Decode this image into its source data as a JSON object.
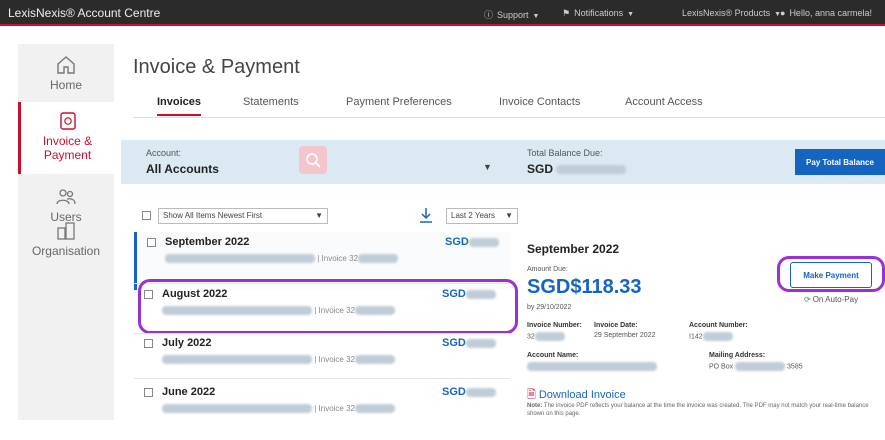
{
  "topbar": {
    "brand": "LexisNexis® Account Centre",
    "support": "Support",
    "notifications": "Notifications",
    "products": "LexisNexis® Products",
    "user": "Hello, anna carmela!"
  },
  "sidebar": {
    "items": [
      {
        "label": "Home"
      },
      {
        "label": "Invoice & Payment"
      },
      {
        "label": "Users"
      },
      {
        "label": "Organisation"
      }
    ]
  },
  "page": {
    "title": "Invoice & Payment"
  },
  "tabs": [
    {
      "label": "Invoices"
    },
    {
      "label": "Statements"
    },
    {
      "label": "Payment Preferences"
    },
    {
      "label": "Invoice Contacts"
    },
    {
      "label": "Account Access"
    }
  ],
  "account": {
    "label": "Account:",
    "value": "All Accounts",
    "balance_label": "Total Balance Due:",
    "currency": "SGD",
    "pay_total": "Pay Total Balance"
  },
  "filter": {
    "show": "Show All Items  Newest First",
    "period": "Last 2 Years"
  },
  "invoices": [
    {
      "month": "September 2022",
      "ref": "| Invoice 32",
      "currency": "SGD"
    },
    {
      "month": "August 2022",
      "ref": "| Invoice 32",
      "currency": "SGD"
    },
    {
      "month": "July 2022",
      "ref": "| Invoice 32",
      "currency": "SGD"
    },
    {
      "month": "June 2022",
      "ref": "| Invoice 32",
      "currency": "SGD"
    }
  ],
  "detail": {
    "title": "September 2022",
    "amount_due_label": "Amount Due:",
    "amount_due": "SGD$118.33",
    "due_date": "by 29/10/2022",
    "invoice_number_label": "Invoice Number:",
    "invoice_number": "32",
    "invoice_date_label": "Invoice Date:",
    "invoice_date": "29 September 2022",
    "account_number_label": "Account Number:",
    "account_number": "I142",
    "account_name_label": "Account Name:",
    "mailing_address_label": "Mailing Address:",
    "mailing_address": "PO Box",
    "mailing_address_end": "3585",
    "make_payment": "Make Payment",
    "autopay": "On Auto-Pay",
    "download": "Download Invoice",
    "note_label": "Note:",
    "note": " The invoice PDF reflects your balance at the time the invoice was created. The PDF may not match your real-time balance shown on this page."
  }
}
